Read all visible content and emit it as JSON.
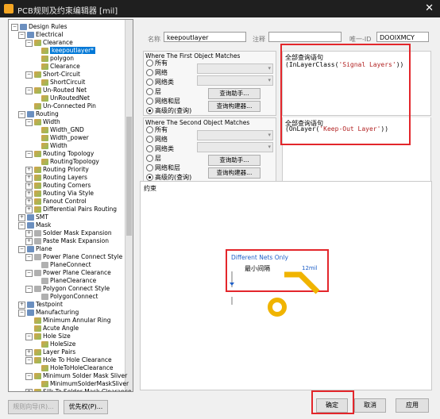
{
  "window": {
    "title": "PCB规则及约束编辑器 [mil]",
    "close_glyph": "✕"
  },
  "tree": {
    "rows": [
      {
        "label": "Design Rules",
        "level": 0,
        "icon": "cat",
        "expander": "−"
      },
      {
        "label": "Electrical",
        "level": 1,
        "icon": "cat",
        "expander": "−"
      },
      {
        "label": "Clearance",
        "level": 2,
        "icon": "rule",
        "expander": "−"
      },
      {
        "label": "keepoutlayer*",
        "level": 3,
        "icon": "rule",
        "expander": "",
        "selected": true
      },
      {
        "label": "polygon",
        "level": 3,
        "icon": "rule",
        "expander": ""
      },
      {
        "label": "Clearance",
        "level": 3,
        "icon": "rule",
        "expander": ""
      },
      {
        "label": "Short-Circuit",
        "level": 2,
        "icon": "rule",
        "expander": "−"
      },
      {
        "label": "ShortCircuit",
        "level": 3,
        "icon": "rule",
        "expander": ""
      },
      {
        "label": "Un-Routed Net",
        "level": 2,
        "icon": "rule",
        "expander": "−"
      },
      {
        "label": "UnRoutedNet",
        "level": 3,
        "icon": "rule",
        "expander": ""
      },
      {
        "label": "Un-Connected Pin",
        "level": 2,
        "icon": "rule",
        "expander": ""
      },
      {
        "label": "Routing",
        "level": 1,
        "icon": "cat",
        "expander": "−"
      },
      {
        "label": "Width",
        "level": 2,
        "icon": "rule",
        "expander": "−"
      },
      {
        "label": "Width_GND",
        "level": 3,
        "icon": "rule",
        "expander": ""
      },
      {
        "label": "Width_power",
        "level": 3,
        "icon": "rule",
        "expander": ""
      },
      {
        "label": "Width",
        "level": 3,
        "icon": "rule",
        "expander": ""
      },
      {
        "label": "Routing Topology",
        "level": 2,
        "icon": "rule",
        "expander": "−"
      },
      {
        "label": "RoutingTopology",
        "level": 3,
        "icon": "rule",
        "expander": ""
      },
      {
        "label": "Routing Priority",
        "level": 2,
        "icon": "rule",
        "expander": "+"
      },
      {
        "label": "Routing Layers",
        "level": 2,
        "icon": "rule",
        "expander": "+"
      },
      {
        "label": "Routing Corners",
        "level": 2,
        "icon": "rule",
        "expander": "+"
      },
      {
        "label": "Routing Via Style",
        "level": 2,
        "icon": "rule",
        "expander": "+"
      },
      {
        "label": "Fanout Control",
        "level": 2,
        "icon": "rule",
        "expander": "+"
      },
      {
        "label": "Differential Pairs Routing",
        "level": 2,
        "icon": "rule",
        "expander": "+"
      },
      {
        "label": "SMT",
        "level": 1,
        "icon": "cat",
        "expander": "+"
      },
      {
        "label": "Mask",
        "level": 1,
        "icon": "cat",
        "expander": "−"
      },
      {
        "label": "Solder Mask Expansion",
        "level": 2,
        "icon": "sm",
        "expander": "+"
      },
      {
        "label": "Paste Mask Expansion",
        "level": 2,
        "icon": "sm",
        "expander": "+"
      },
      {
        "label": "Plane",
        "level": 1,
        "icon": "cat",
        "expander": "−"
      },
      {
        "label": "Power Plane Connect Style",
        "level": 2,
        "icon": "sm",
        "expander": "−"
      },
      {
        "label": "PlaneConnect",
        "level": 3,
        "icon": "sm",
        "expander": ""
      },
      {
        "label": "Power Plane Clearance",
        "level": 2,
        "icon": "sm",
        "expander": "−"
      },
      {
        "label": "PlaneClearance",
        "level": 3,
        "icon": "sm",
        "expander": ""
      },
      {
        "label": "Polygon Connect Style",
        "level": 2,
        "icon": "sm",
        "expander": "−"
      },
      {
        "label": "PolygonConnect",
        "level": 3,
        "icon": "sm",
        "expander": ""
      },
      {
        "label": "Testpoint",
        "level": 1,
        "icon": "cat",
        "expander": "+"
      },
      {
        "label": "Manufacturing",
        "level": 1,
        "icon": "cat",
        "expander": "−"
      },
      {
        "label": "Minimum Annular Ring",
        "level": 2,
        "icon": "rule",
        "expander": ""
      },
      {
        "label": "Acute Angle",
        "level": 2,
        "icon": "rule",
        "expander": ""
      },
      {
        "label": "Hole Size",
        "level": 2,
        "icon": "rule",
        "expander": "−"
      },
      {
        "label": "HoleSize",
        "level": 3,
        "icon": "rule",
        "expander": ""
      },
      {
        "label": "Layer Pairs",
        "level": 2,
        "icon": "rule",
        "expander": "+"
      },
      {
        "label": "Hole To Hole Clearance",
        "level": 2,
        "icon": "rule",
        "expander": "−"
      },
      {
        "label": "HoleToHoleClearance",
        "level": 3,
        "icon": "rule",
        "expander": ""
      },
      {
        "label": "Minimum Solder Mask Sliver",
        "level": 2,
        "icon": "rule",
        "expander": "−"
      },
      {
        "label": "MinimumSolderMaskSliver",
        "level": 3,
        "icon": "rule",
        "expander": ""
      },
      {
        "label": "Silk To Solder Mask Clearance",
        "level": 2,
        "icon": "rule",
        "expander": "+"
      }
    ]
  },
  "header": {
    "name_label": "名称",
    "name_value": "keepoutlayer",
    "comment_label": "注释",
    "comment_value": "",
    "uid_label": "唯一-ID",
    "uid_value": "DOOIXMCY"
  },
  "first_match": {
    "title": "Where The First Object Matches",
    "options": [
      "所有",
      "网络",
      "网络类",
      "层",
      "网络和层",
      "高级的(查询)"
    ],
    "selected": 5,
    "helper_button": "查询助手...",
    "builder_button": "查询构建器...",
    "query_label": "全部查询语句",
    "query_prefix": "(InLayerClass(",
    "query_arg": "'Signal Layers'",
    "query_suffix": "))"
  },
  "second_match": {
    "title": "Where The Second Object Matches",
    "options": [
      "所有",
      "网络",
      "网络类",
      "层",
      "网络和层",
      "高级的(查询)"
    ],
    "selected": 5,
    "helper_button": "查询助手...",
    "builder_button": "查询构建器...",
    "query_label": "全部查询语句",
    "query_prefix": "(OnLayer(",
    "query_arg": "'Keep-Out Layer'",
    "query_suffix": "))"
  },
  "constraint": {
    "title": "约束",
    "nets_option": "Different Nets Only",
    "min_clearance_label": "最小间隔",
    "min_clearance_value": "12mil"
  },
  "footer": {
    "defaults_button": "规则向导(R)...",
    "priority_button": "优先权(P)...",
    "ok_button": "确定",
    "cancel_button": "取消",
    "apply_button": "应用"
  },
  "colors": {
    "highlight": "#e3262b",
    "accent": "#0078d7",
    "track": "#f0b400"
  }
}
